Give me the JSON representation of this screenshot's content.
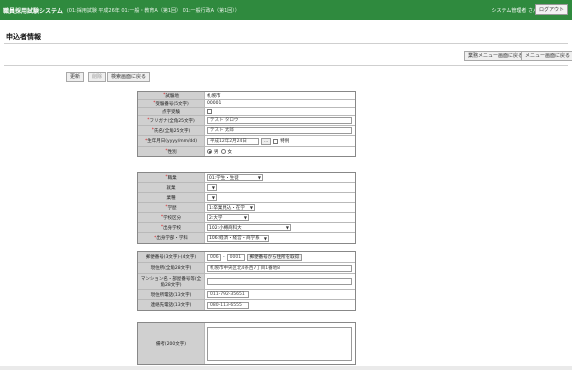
{
  "header": {
    "system_name": "職員採用試験システム",
    "context": "(01:採用試験 平成26年 01:一般・教育A（第1回） 01:一般行政A（第1回））",
    "user": "システム管理者 さん",
    "logout": "ログアウト",
    "bg_color": "#2f8a3e"
  },
  "page_title": "申込者情報",
  "nav": {
    "back_exam_menu": "業務メニュー画面に戻る",
    "back_main_menu": "メニュー画面に戻る"
  },
  "actions": {
    "update": "更新",
    "delete": "削除",
    "back_search": "検索画面に戻る"
  },
  "section1": {
    "exam_site": {
      "label": "試験地",
      "value": "札幌市"
    },
    "applicant_no": {
      "label": "受験番号(5文字)",
      "value": "00001"
    },
    "braille": {
      "label": "点字受験"
    },
    "furigana": {
      "label": "フリガナ(全角25文字)",
      "value": "テスト タロウ"
    },
    "name": {
      "label": "氏名(全角25文字)",
      "value": "テスト 太郎"
    },
    "birthdate": {
      "label": "生年月日(yyyy/mm/dd)",
      "value": "平成12年2月24日",
      "picker": "...",
      "special": "特例"
    },
    "gender": {
      "label": "性別",
      "male": "男",
      "female": "女"
    }
  },
  "section2": {
    "occupation": {
      "label": "職業",
      "value": "01:学生・生徒"
    },
    "position": {
      "label": "就業",
      "value": ""
    },
    "industry": {
      "label": "業種",
      "value": ""
    },
    "education": {
      "label": "学歴",
      "value": "1:卒業見込・在学"
    },
    "school_type": {
      "label": "学校区分",
      "value": "2:大学"
    },
    "school": {
      "label": "出身学校",
      "value": "102:小樽商科大"
    },
    "faculty": {
      "label": "出身学部・学科",
      "value": "106:経済・経営・商学系"
    }
  },
  "section3": {
    "postal": {
      "label": "郵便番号(3文字)-(4文字)",
      "value1": "006",
      "value2": "0001",
      "button": "郵便番号から住所を取得"
    },
    "address": {
      "label": "現住所(全角28文字)",
      "value": "札幌市中央区北4条西7丁目1番地8"
    },
    "building": {
      "label": "マンション名・部屋番号等(全角28文字)",
      "value": ""
    },
    "home_phone": {
      "label": "現住所電話(13文字)",
      "value": "011-792-35651"
    },
    "contact_phone": {
      "label": "連絡先電話(13文字)",
      "value": "080-113-6555"
    }
  },
  "section4": {
    "remarks": {
      "label": "備考(200文字)",
      "value": ""
    }
  }
}
